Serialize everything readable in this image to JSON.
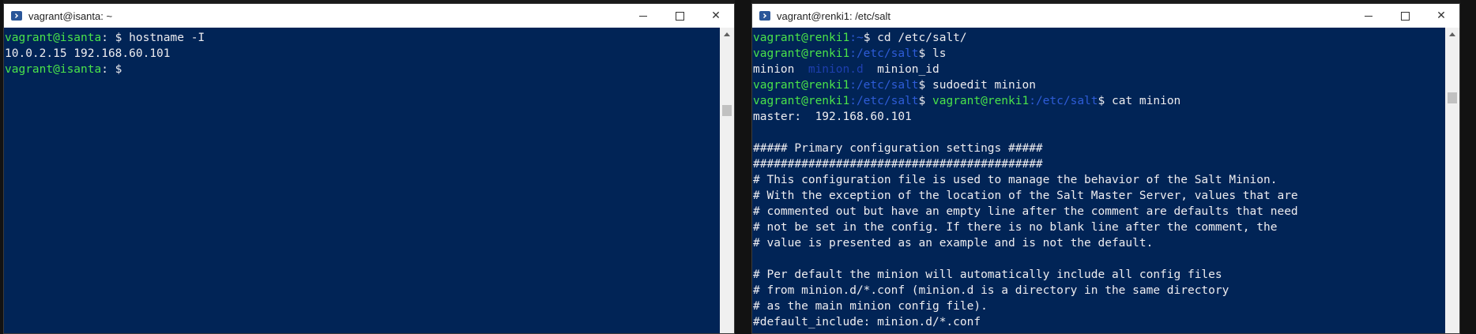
{
  "left_window": {
    "title": "vagrant@isanta: ~",
    "lines": [
      [
        [
          "u",
          "vagrant@isanta"
        ],
        [
          "t",
          ": $ hostname -I"
        ]
      ],
      [
        [
          "t",
          "10.0.2.15 192.168.60.101"
        ]
      ],
      [
        [
          "u",
          "vagrant@isanta"
        ],
        [
          "t",
          ": $"
        ]
      ]
    ]
  },
  "right_window": {
    "title": "vagrant@renki1: /etc/salt",
    "lines": [
      [
        [
          "u",
          "vagrant@renki1"
        ],
        [
          "p",
          ":~"
        ],
        [
          "t",
          "$ cd /etc/salt/"
        ]
      ],
      [
        [
          "u",
          "vagrant@renki1"
        ],
        [
          "p",
          ":/etc/salt"
        ],
        [
          "t",
          "$ ls"
        ]
      ],
      [
        [
          "t",
          "minion  "
        ],
        [
          "d",
          "minion.d"
        ],
        [
          "t",
          "  minion_id"
        ]
      ],
      [
        [
          "u",
          "vagrant@renki1"
        ],
        [
          "p",
          ":/etc/salt"
        ],
        [
          "t",
          "$ sudoedit minion"
        ]
      ],
      [
        [
          "u",
          "vagrant@renki1"
        ],
        [
          "p",
          ":/etc/salt"
        ],
        [
          "t",
          "$ "
        ],
        [
          "u",
          "vagrant@renki1"
        ],
        [
          "p",
          ":/etc/salt"
        ],
        [
          "t",
          "$ cat minion"
        ]
      ],
      [
        [
          "t",
          "master:  192.168.60.101"
        ]
      ],
      [
        [
          "t",
          ""
        ]
      ],
      [
        [
          "t",
          "##### Primary configuration settings #####"
        ]
      ],
      [
        [
          "t",
          "##########################################"
        ]
      ],
      [
        [
          "t",
          "# This configuration file is used to manage the behavior of the Salt Minion."
        ]
      ],
      [
        [
          "t",
          "# With the exception of the location of the Salt Master Server, values that are"
        ]
      ],
      [
        [
          "t",
          "# commented out but have an empty line after the comment are defaults that need"
        ]
      ],
      [
        [
          "t",
          "# not be set in the config. If there is no blank line after the comment, the"
        ]
      ],
      [
        [
          "t",
          "# value is presented as an example and is not the default."
        ]
      ],
      [
        [
          "t",
          ""
        ]
      ],
      [
        [
          "t",
          "# Per default the minion will automatically include all config files"
        ]
      ],
      [
        [
          "t",
          "# from minion.d/*.conf (minion.d is a directory in the same directory"
        ]
      ],
      [
        [
          "t",
          "# as the main minion config file)."
        ]
      ],
      [
        [
          "t",
          "#default_include: minion.d/*.conf"
        ]
      ]
    ]
  },
  "colors": {
    "terminal_bg": "#012456",
    "user_host": "#4ae34a",
    "path": "#2e5cd8",
    "directory": "#1e3fb0",
    "text": "#eeedf0"
  }
}
